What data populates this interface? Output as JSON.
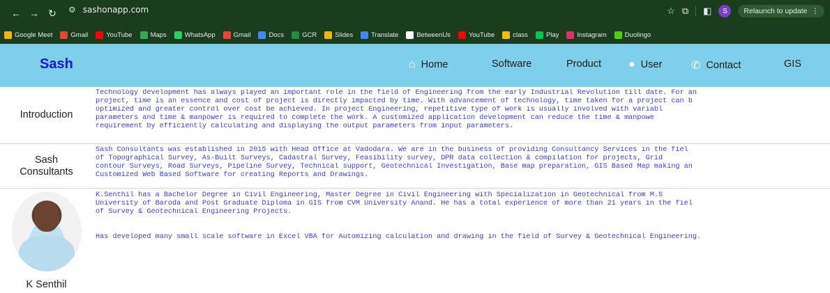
{
  "browser": {
    "url": "sashonapp.com",
    "relaunch_label": "Relaunch to update",
    "profile_initial": "S"
  },
  "bookmarks": [
    {
      "label": "Google Meet",
      "color": "#f4b400"
    },
    {
      "label": "Gmail",
      "color": "#ea4335"
    },
    {
      "label": "YouTube",
      "color": "#ff0000"
    },
    {
      "label": "Maps",
      "color": "#34a853"
    },
    {
      "label": "WhatsApp",
      "color": "#25d366"
    },
    {
      "label": "Gmail",
      "color": "#ea4335"
    },
    {
      "label": "Docs",
      "color": "#4285f4"
    },
    {
      "label": "GCR",
      "color": "#1e8e3e"
    },
    {
      "label": "Slides",
      "color": "#f4b400"
    },
    {
      "label": "Translate",
      "color": "#4285f4"
    },
    {
      "label": "BetweenUs",
      "color": "#ffffff"
    },
    {
      "label": "YouTube",
      "color": "#ff0000"
    },
    {
      "label": "class",
      "color": "#fbbc04"
    },
    {
      "label": "Play",
      "color": "#00c853"
    },
    {
      "label": "Instagram",
      "color": "#e1306c"
    },
    {
      "label": "Duolingo",
      "color": "#58cc02"
    }
  ],
  "site": {
    "brand": "Sash",
    "menu": {
      "home": "Home",
      "software": "Software",
      "product": "Product",
      "user": "User",
      "contact": "Contact",
      "gis": "GIS"
    }
  },
  "sections": {
    "intro": {
      "label": "Introduction",
      "lines": [
        "Technology development has always played an important role in the field of Engineering from the early Industrial Revolution till date. For an",
        "project, time is an essence and cost of project is directly impacted by time. With advancement of technology, time taken for a project can b",
        "optimized and greater control over cost be achieved. In project Engineering, repetitive type of work is usually involved with variabl",
        "parameters and time & manpower is required to complete the work. A customized application development can reduce the time & manpowe",
        "requirement by efficiently calculating and displaying the output parameters from input parameters."
      ]
    },
    "sash": {
      "label_line1": "Sash",
      "label_line2": "Consultants",
      "lines": [
        "Sash Consultants was established in 2015 with Head Office at Vadodara. We are in the business of providing Consultancy Services in the fiel",
        "of Topographical Survey, As-Built Surveys, Cadastral Survey, Feasibility survey, DPR data collection & compilation for projects, Grid",
        "contour Surveys, Road Surveys, Pipeline Survey, Technical support, Geotechnical Investigation, Base map preparation, GIS Based Map making an",
        "Customized Web Based Software for creating Reports and Drawings."
      ]
    },
    "senthil": {
      "name": "K Senthil",
      "lines": [
        "K.Senthil has a Bachelor Degree in Civil Engineering, Master Degree in Civil Engineering with Specialization in Geotechnical from M.S",
        "University of Baroda and Post Graduate Diploma in GIS from CVM University Anand. He has a total experience of more than 21 years in the fiel",
        "of Survey & Geotechnical Engineering Projects."
      ],
      "extra": "Has developed many small scale software in Excel VBA for Automizing calculation and drawing in the field of Survey & Geotechnical Engineering."
    }
  }
}
